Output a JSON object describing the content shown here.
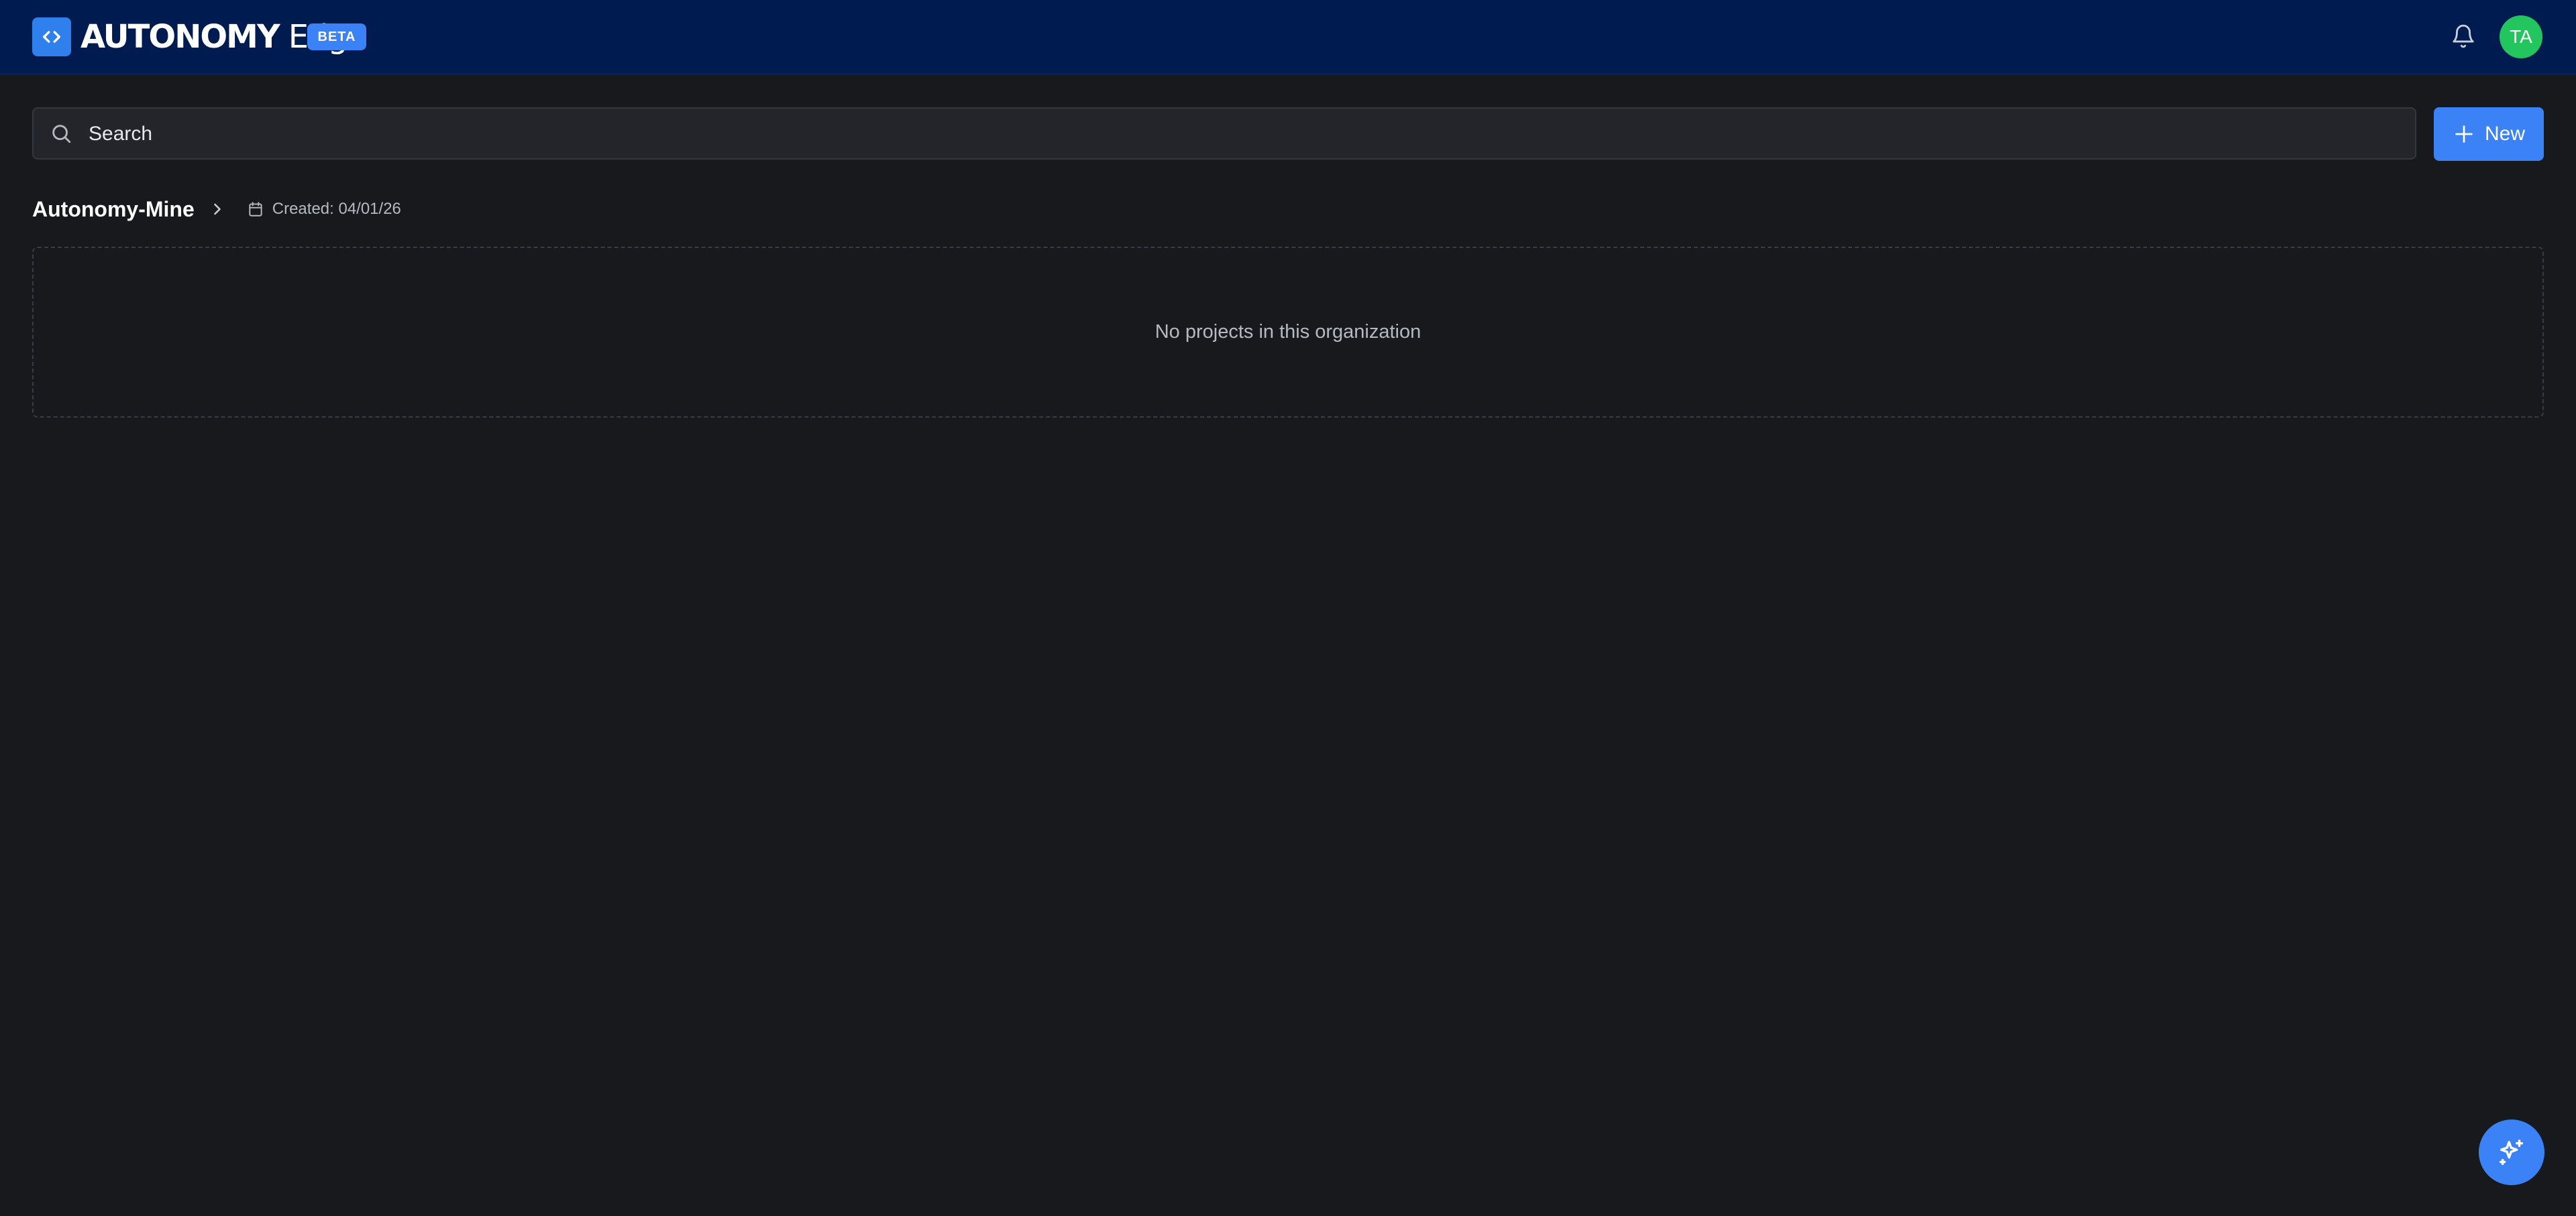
{
  "header": {
    "brand_main": "AUTONOMY",
    "brand_sub": "Edge",
    "badge": "BETA",
    "avatar_initials": "TA"
  },
  "search": {
    "placeholder": "Search",
    "value": ""
  },
  "toolbar": {
    "new_label": "New"
  },
  "breadcrumb": {
    "org_name": "Autonomy-Mine",
    "created": "Created: 04/01/26"
  },
  "projects": {
    "empty_message": "No projects in this organization"
  },
  "icons": {
    "logo": "code-brackets-icon",
    "notifications": "bell-icon",
    "search": "search-icon",
    "new": "plus-icon",
    "breadcrumb_separator": "chevron-right-icon",
    "created": "calendar-icon",
    "assistant": "sparkles-icon"
  },
  "colors": {
    "header_bg": "#001b4f",
    "page_bg": "#18191d",
    "accent": "#3b82f6",
    "avatar": "#22c55e"
  }
}
